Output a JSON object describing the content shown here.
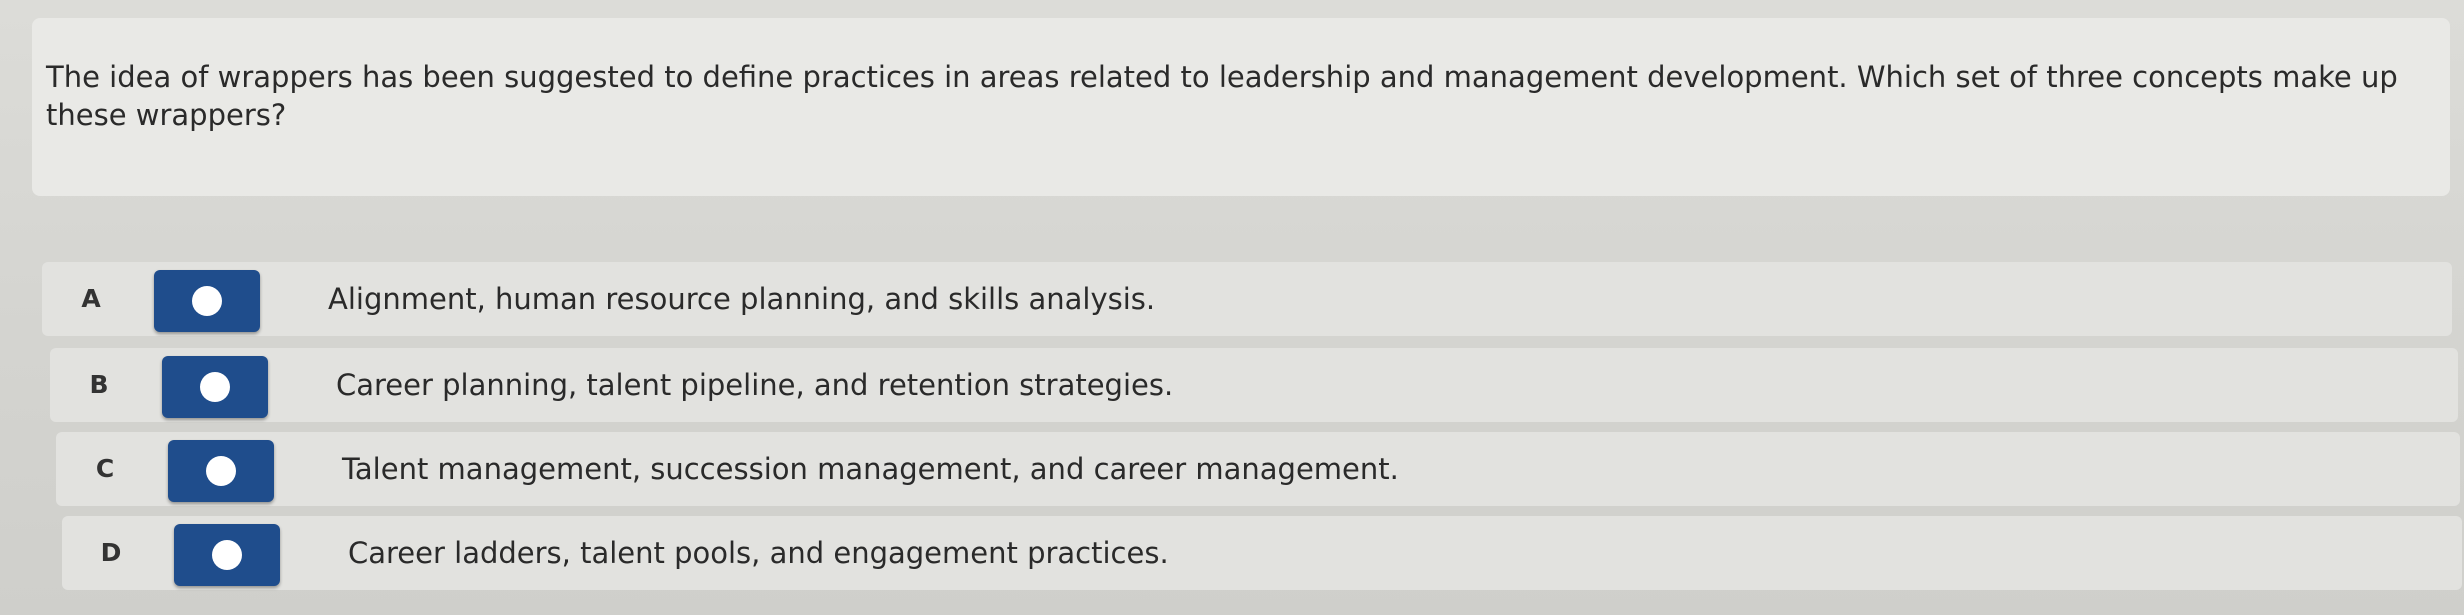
{
  "question": {
    "text": "The idea of wrappers has been suggested to define practices in areas related to leadership and management development. Which set of three concepts make up these wrappers?"
  },
  "options": [
    {
      "letter": "A",
      "text": "Alignment, human resource planning, and skills analysis."
    },
    {
      "letter": "B",
      "text": "Career planning, talent pipeline, and retention strategies."
    },
    {
      "letter": "C",
      "text": "Talent management, succession management, and career management."
    },
    {
      "letter": "D",
      "text": "Career ladders, talent pools, and engagement practices."
    }
  ],
  "colors": {
    "radio_button": "#1f4d8c",
    "card_background": "#e9e9e6"
  }
}
